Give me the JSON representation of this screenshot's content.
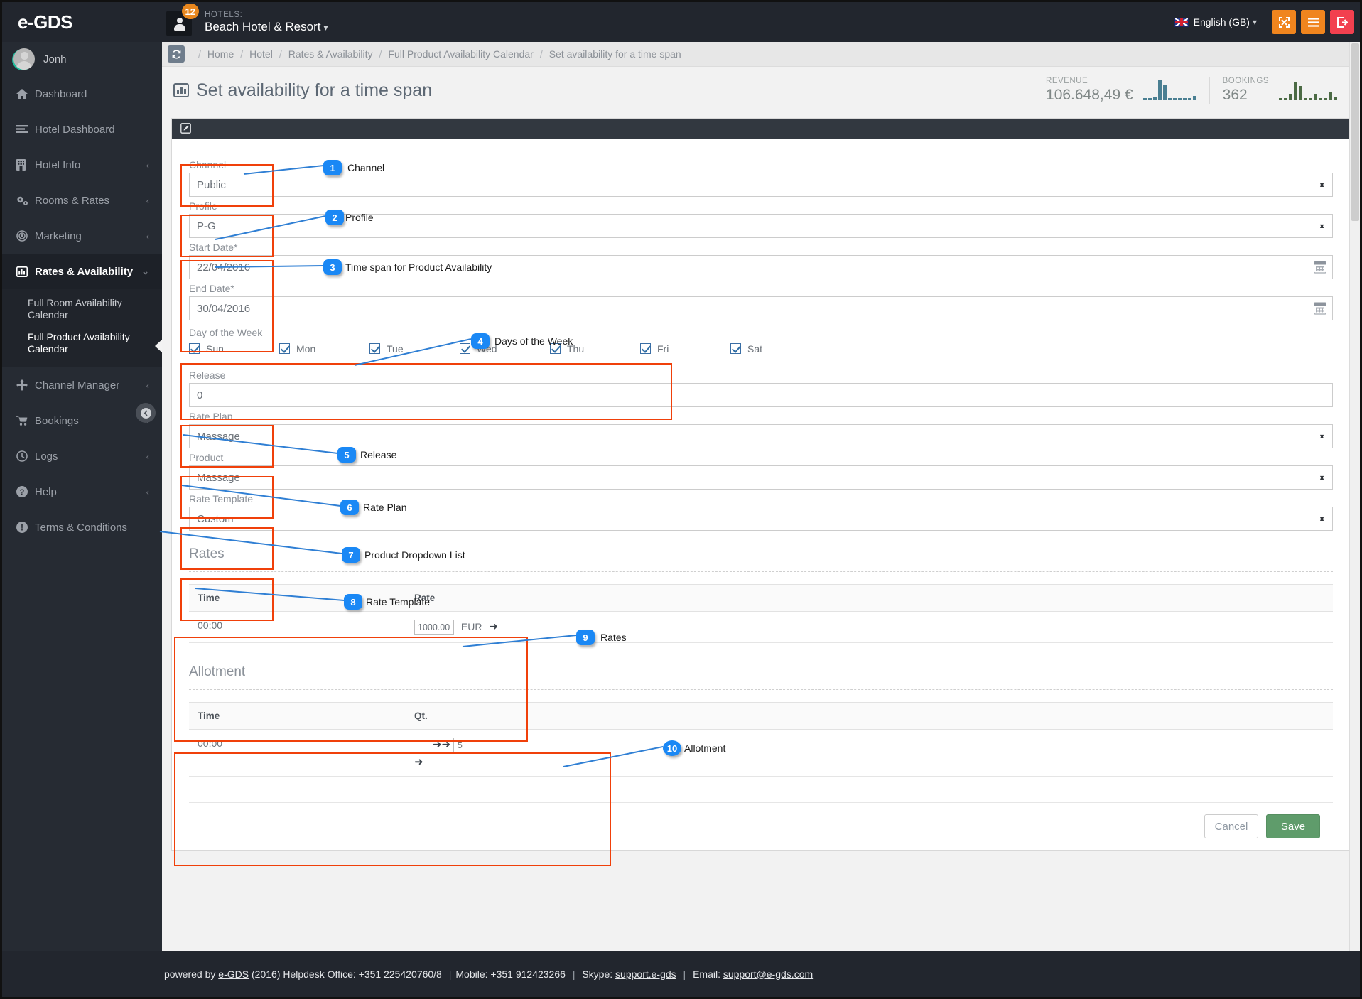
{
  "brand": {
    "name": "e-GDS"
  },
  "topbar": {
    "notification_count": "12",
    "hotels_label": "HOTELS:",
    "hotel_name": "Beach Hotel & Resort",
    "language": "English (GB)",
    "buttons": {
      "fullscreen": "fullscreen-button",
      "menu": "menu-button",
      "logout": "logout-button"
    }
  },
  "sidebar": {
    "user": "Jonh",
    "items": [
      {
        "label": "Dashboard",
        "icon": "home-icon",
        "has_arrow": false
      },
      {
        "label": "Hotel Dashboard",
        "icon": "list-icon",
        "has_arrow": false
      },
      {
        "label": "Hotel Info",
        "icon": "building-icon",
        "has_arrow": true
      },
      {
        "label": "Rooms & Rates",
        "icon": "gears-icon",
        "has_arrow": true
      },
      {
        "label": "Marketing",
        "icon": "target-icon",
        "has_arrow": true
      },
      {
        "label": "Rates & Availability",
        "icon": "bar-chart-icon",
        "has_arrow": true,
        "active": true
      },
      {
        "label": "Channel Manager",
        "icon": "arrows-icon",
        "has_arrow": true
      },
      {
        "label": "Bookings",
        "icon": "cart-icon",
        "has_arrow": true
      },
      {
        "label": "Logs",
        "icon": "clock-icon",
        "has_arrow": true
      },
      {
        "label": "Help",
        "icon": "question-circle-icon",
        "has_arrow": true
      },
      {
        "label": "Terms & Conditions",
        "icon": "exclamation-circle-icon",
        "has_arrow": false
      }
    ],
    "subitems": [
      {
        "label": "Full Room Availability Calendar"
      },
      {
        "label": "Full Product Availability Calendar",
        "current": true
      }
    ]
  },
  "breadcrumbs": [
    "Home",
    "Hotel",
    "Rates & Availability",
    "Full Product Availability Calendar",
    "Set availability for a time span"
  ],
  "page": {
    "title": "Set availability for a time span"
  },
  "stats": [
    {
      "label": "REVENUE",
      "value": "106.648,49 €",
      "color": "#4a7f92",
      "spark": [
        3,
        3,
        5,
        28,
        22,
        3,
        3,
        3,
        3,
        3,
        6
      ]
    },
    {
      "label": "BOOKINGS",
      "value": "362",
      "color": "#4c6b45",
      "spark": [
        3,
        3,
        9,
        26,
        20,
        3,
        3,
        9,
        3,
        3,
        11,
        4
      ]
    }
  ],
  "form": {
    "channel": {
      "label": "Channel",
      "value": "Public"
    },
    "profile": {
      "label": "Profile",
      "value": "P-G"
    },
    "start_date": {
      "label": "Start Date*",
      "value": "22/04/2016"
    },
    "end_date": {
      "label": "End Date*",
      "value": "30/04/2016"
    },
    "day_of_week": {
      "label": "Day of the Week",
      "days": [
        {
          "label": "Sun",
          "checked": true
        },
        {
          "label": "Mon",
          "checked": true
        },
        {
          "label": "Tue",
          "checked": true
        },
        {
          "label": "Wed",
          "checked": true
        },
        {
          "label": "Thu",
          "checked": true
        },
        {
          "label": "Fri",
          "checked": true
        },
        {
          "label": "Sat",
          "checked": true
        }
      ]
    },
    "release": {
      "label": "Release",
      "value": "0"
    },
    "rate_plan": {
      "label": "Rate Plan",
      "value": "Massage"
    },
    "product": {
      "label": "Product",
      "value": "Massage"
    },
    "rate_template": {
      "label": "Rate Template",
      "value": "Custom"
    }
  },
  "rates": {
    "title": "Rates",
    "columns": [
      "Time",
      "Rate"
    ],
    "rows": [
      {
        "time": "00:00",
        "rate": "1000.00",
        "currency": "EUR"
      }
    ]
  },
  "allotment": {
    "title": "Allotment",
    "columns": [
      "Time",
      "Qt."
    ],
    "rows": [
      {
        "time": "00:00",
        "qty_placeholder": "5"
      }
    ]
  },
  "actions": {
    "cancel": "Cancel",
    "save": "Save"
  },
  "footer": {
    "prefix": "powered by ",
    "brand": "e-GDS",
    "year_office": " (2016) Helpdesk Office: +351 225420760/8 ",
    "mobile": "Mobile: +351 912423266 ",
    "skype_label": "Skype: ",
    "skype": "support.e-gds",
    "email_label": "Email: ",
    "email": "support@e-gds.com"
  },
  "annotations": [
    {
      "n": "1",
      "text": "Channel"
    },
    {
      "n": "2",
      "text": "Profile"
    },
    {
      "n": "3",
      "text": "Time span for Product Availability"
    },
    {
      "n": "4",
      "text": "Days of the Week"
    },
    {
      "n": "5",
      "text": "Release"
    },
    {
      "n": "6",
      "text": "Rate Plan"
    },
    {
      "n": "7",
      "text": "Product Dropdown List"
    },
    {
      "n": "8",
      "text": "Rate Template"
    },
    {
      "n": "9",
      "text": "Rates"
    },
    {
      "n": "10",
      "text": "Allotment"
    }
  ]
}
